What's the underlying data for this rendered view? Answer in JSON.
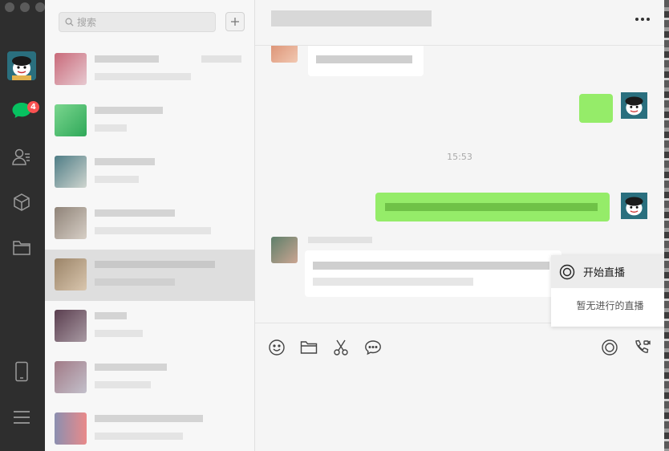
{
  "colors": {
    "nav_bg": "#2e2e2e",
    "badge": "#fa5151",
    "self_bubble": "#95ec69",
    "accent_green": "#07c160"
  },
  "nav": {
    "unread_badge": "4",
    "icons": [
      "chat-icon",
      "contacts-icon",
      "favorites-icon",
      "folder-icon",
      "phone-icon",
      "menu-icon"
    ]
  },
  "chat_list": {
    "search_placeholder": "搜索"
  },
  "conversation": {
    "time_divider": "15:53"
  },
  "live_popup": {
    "start_label": "开始直播",
    "status": "暂无进行的直播"
  }
}
